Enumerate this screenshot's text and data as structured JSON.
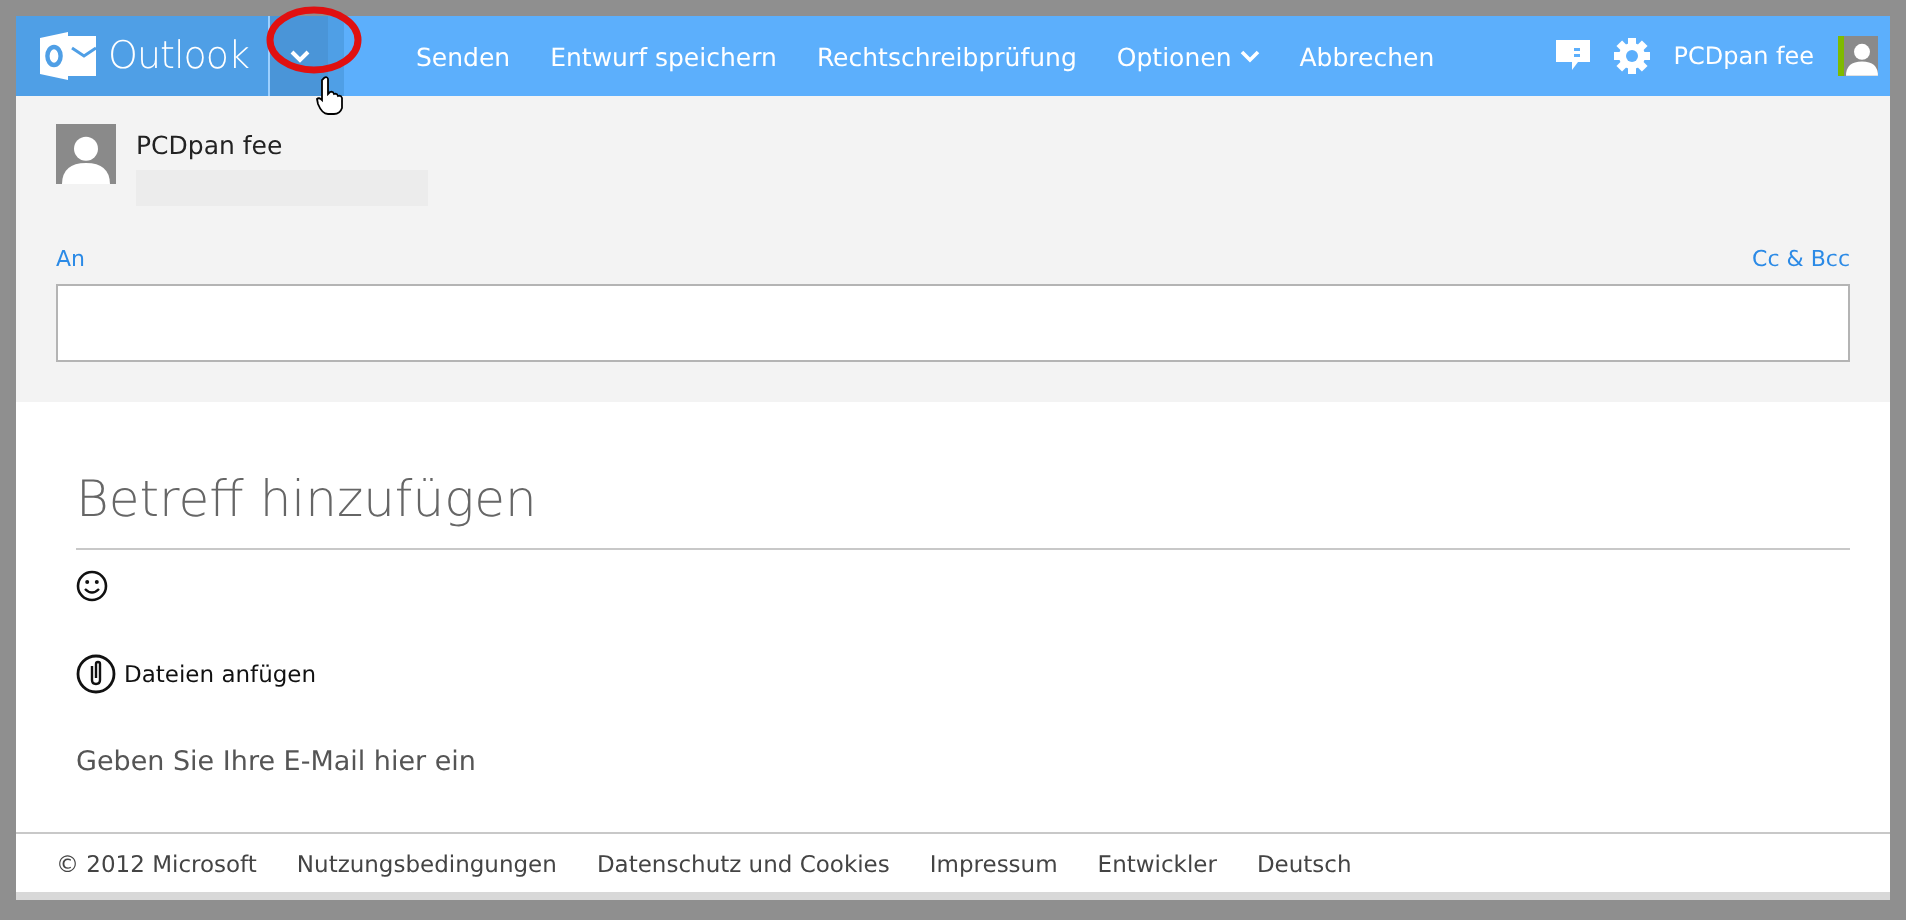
{
  "header": {
    "app_name": "Outlook",
    "commands": [
      {
        "label": "Senden",
        "kind": "text"
      },
      {
        "label": "Entwurf speichern",
        "kind": "text"
      },
      {
        "label": "Rechtschreibprüfung",
        "kind": "text"
      },
      {
        "label": "Optionen",
        "kind": "dropdown"
      },
      {
        "label": "Abbrechen",
        "kind": "text"
      }
    ],
    "user_name": "PCDpan fee"
  },
  "sender": {
    "name": "PCDpan fee"
  },
  "recipients": {
    "to_label": "An",
    "cc_label": "Cc & Bcc"
  },
  "subject": {
    "placeholder": "Betreff hinzufügen"
  },
  "attach": {
    "label": "Dateien anfügen"
  },
  "body": {
    "placeholder": "Geben Sie Ihre E-Mail hier ein"
  },
  "footer": [
    "© 2012 Microsoft",
    "Nutzungsbedingungen",
    "Datenschutz und Cookies",
    "Impressum",
    "Entwickler",
    "Deutsch"
  ]
}
